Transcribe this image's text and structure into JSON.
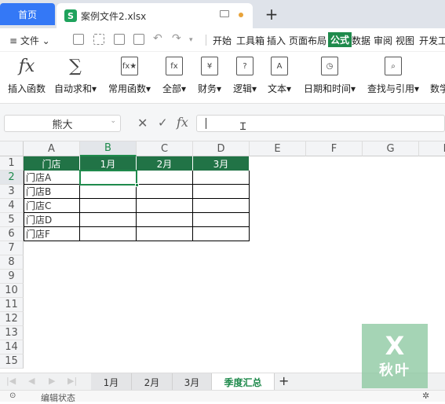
{
  "titlebar": {
    "home_tab": "首页",
    "file_tab": "案例文件2.xlsx",
    "file_icon": "S",
    "new_tab": "+"
  },
  "menubar": {
    "file_menu": "≡ 文件 ⌄",
    "tabs": [
      "开始",
      "工具箱",
      "插入",
      "页面布局",
      "公式",
      "数据",
      "审阅",
      "视图",
      "开发工"
    ]
  },
  "ribbon": {
    "buttons": [
      {
        "label": "插入函数",
        "icon": "fx"
      },
      {
        "label": "自动求和▾",
        "icon": "∑"
      },
      {
        "label": "常用函数▾",
        "icon": "fx★"
      },
      {
        "label": "全部▾",
        "icon": "fx"
      },
      {
        "label": "财务▾",
        "icon": "¥"
      },
      {
        "label": "逻辑▾",
        "icon": "?"
      },
      {
        "label": "文本▾",
        "icon": "A"
      },
      {
        "label": "日期和时间▾",
        "icon": "◷"
      },
      {
        "label": "查找与引用▾",
        "icon": "⌕"
      },
      {
        "label": "数学",
        "icon": ""
      }
    ]
  },
  "formula_bar": {
    "name_box": "熊大",
    "cancel": "✕",
    "confirm": "✓",
    "fx": "fx",
    "value": ""
  },
  "grid": {
    "columns": [
      "A",
      "B",
      "C",
      "D",
      "E",
      "F",
      "G",
      "H"
    ],
    "rows": [
      "1",
      "2",
      "3",
      "4",
      "5",
      "6",
      "7",
      "8",
      "9",
      "10",
      "11",
      "12",
      "13",
      "14",
      "15"
    ],
    "selected_cell": "B2",
    "table_headers": [
      "门店",
      "1月",
      "2月",
      "3月"
    ],
    "table_rows": [
      "门店A",
      "门店B",
      "门店C",
      "门店D",
      "门店F"
    ],
    "header_color": "#217346"
  },
  "sheets": {
    "tabs": [
      "1月",
      "2月",
      "3月",
      "季度汇总"
    ],
    "active": "季度汇总",
    "add": "+"
  },
  "status": {
    "text": "编辑状态"
  },
  "watermark": {
    "letter": "X",
    "text": "秋叶"
  }
}
